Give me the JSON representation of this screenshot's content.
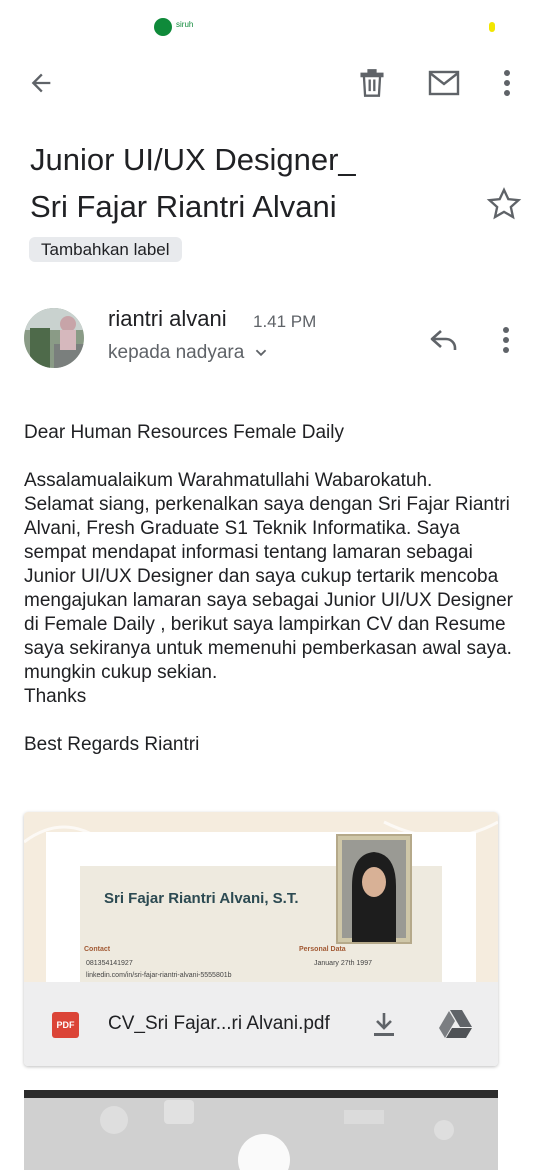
{
  "status_bar": {
    "app_icon": "app-notification-icon",
    "app_text": "siruh",
    "accent": "#f2e600"
  },
  "toolbar": {
    "back_icon": "arrow-back-icon",
    "delete_icon": "trash-icon",
    "mark_unread_icon": "envelope-icon",
    "more_icon": "more-vert-icon"
  },
  "email": {
    "subject_line1": "Junior UI/UX Designer_",
    "subject_line2": "Sri Fajar Riantri Alvani",
    "label_chip": "Tambahkan label",
    "sender_name": "riantri alvani",
    "time": "1.41 PM",
    "recipient": "kepada nadyara",
    "body": {
      "greeting": "Dear Human Resources  Female Daily",
      "line1": "Assalamualaikum Warahmatullahi Wabarokatuh.",
      "line2": "Selamat siang, perkenalkan saya dengan Sri Fajar Riantri Alvani, Fresh Graduate  S1 Teknik Informatika. Saya sempat mendapat informasi tentang lamaran sebagai Junior UI/UX Designer dan saya cukup tertarik mencoba mengajukan lamaran saya sebagai Junior UI/UX Designer di Female Daily , berikut saya lampirkan CV dan Resume  saya sekiranya untuk memenuhi pemberkasan awal saya.",
      "line3": "mungkin cukup sekian.",
      "line4": "Thanks",
      "signoff": "Best Regards Riantri"
    }
  },
  "attachment": {
    "preview_name": "Sri Fajar Riantri Alvani, S.T.",
    "preview_contact_heading": "Contact",
    "preview_personal_heading": "Personal Data",
    "preview_phone": "081354141927",
    "preview_linkedin": "linkedin.com/in/sri-fajar-riantri-alvani-5555801b",
    "preview_birth": "January 27th 1997",
    "file_type": "PDF",
    "file_name": "CV_Sri Fajar...ri Alvani.pdf",
    "download_icon": "download-icon",
    "drive_icon": "google-drive-icon"
  },
  "colors": {
    "pdf_red": "#db4437",
    "secondary_text": "#5f6368"
  }
}
